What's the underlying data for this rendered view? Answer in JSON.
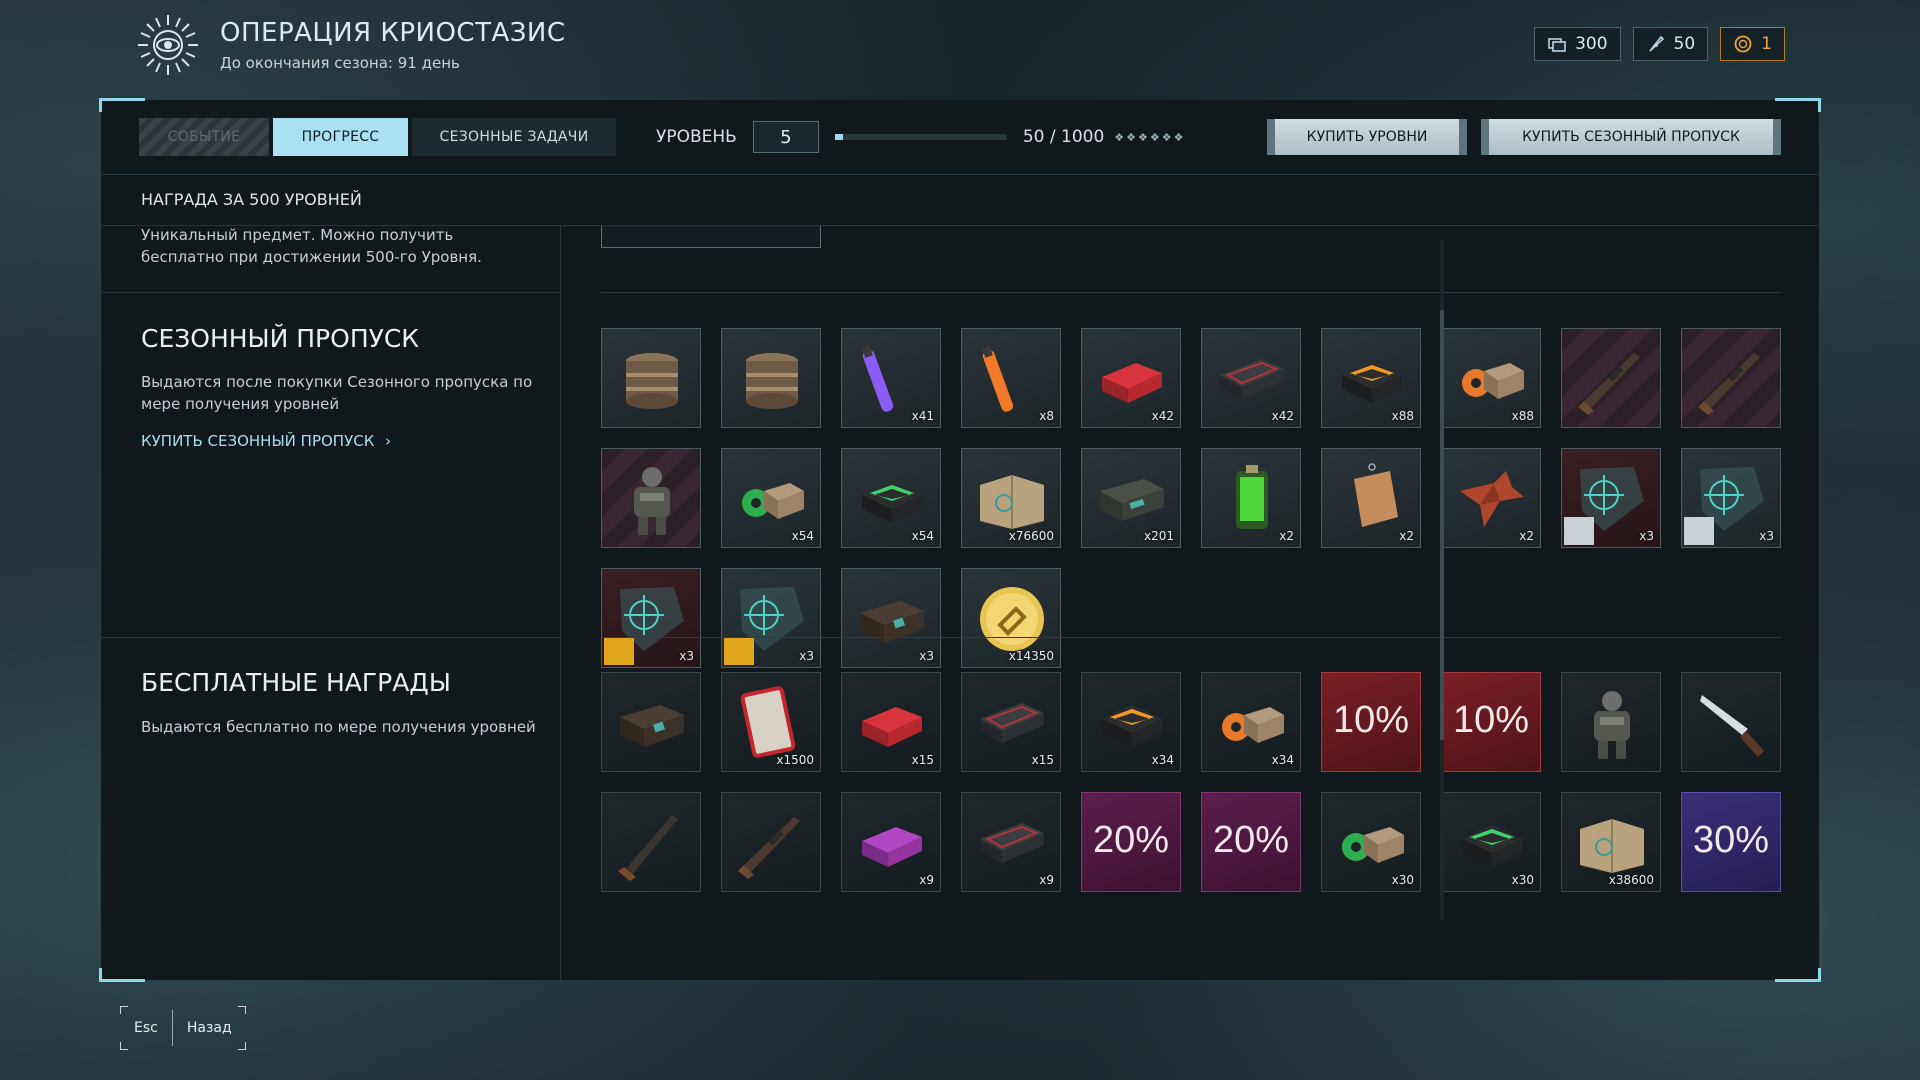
{
  "header": {
    "title": "ОПЕРАЦИЯ КРИОСТАЗИС",
    "subtitle": "До окончания сезона: 91 день"
  },
  "currencies": [
    {
      "icon": "tickets-icon",
      "value": "300"
    },
    {
      "icon": "feather-token-icon",
      "value": "50"
    },
    {
      "icon": "gold-coin-icon",
      "value": "1"
    }
  ],
  "tabs": {
    "event": "СОБЫТИЕ",
    "progress": "ПРОГРЕСС",
    "tasks": "СЕЗОННЫЕ ЗАДАЧИ"
  },
  "level": {
    "label": "УРОВЕНЬ",
    "value": "5",
    "xp_text": "50 / 1000",
    "progress_fraction": 0.05,
    "stars_text": "❖❖❖❖❖❖"
  },
  "buttons": {
    "buy_levels": "КУПИТЬ УРОВНИ",
    "buy_pass": "КУПИТЬ СЕЗОННЫЙ ПРОПУСК"
  },
  "reward500": {
    "title": "НАГРАДА ЗА 500 УРОВНЕЙ",
    "description": "Уникальный предмет. Можно получить бесплатно при достижении 500-го Уровня."
  },
  "season_pass": {
    "title": "СЕЗОННЫЙ ПРОПУСК",
    "description": "Выдаются после покупки Сезонного пропуска по мере получения уровней",
    "link": "КУПИТЬ СЕЗОННЫЙ ПРОПУСК"
  },
  "free_rewards": {
    "title": "БЕСПЛАТНЫЕ НАГРАДЫ",
    "description": "Выдаются бесплатно по мере получения уровней"
  },
  "pass_items": [
    {
      "icon": "drum-container-icon",
      "qty": "",
      "bg": ""
    },
    {
      "icon": "drum-container-icon",
      "qty": "",
      "bg": ""
    },
    {
      "icon": "purple-glowstick-icon",
      "qty": "x41",
      "bg": ""
    },
    {
      "icon": "orange-glowstick-icon",
      "qty": "x8",
      "bg": ""
    },
    {
      "icon": "red-case-icon",
      "qty": "x42",
      "bg": ""
    },
    {
      "icon": "weapon-case-icon",
      "qty": "x42",
      "bg": ""
    },
    {
      "icon": "orange-x-box-icon",
      "qty": "x88",
      "bg": ""
    },
    {
      "icon": "orange-box-icon",
      "qty": "x88",
      "bg": ""
    },
    {
      "icon": "rifle-icon",
      "qty": "",
      "bg": "stripe"
    },
    {
      "icon": "rifle-icon",
      "qty": "",
      "bg": "stripe"
    },
    {
      "icon": "armored-soldier-icon",
      "qty": "",
      "bg": "stripe"
    },
    {
      "icon": "green-box-icon",
      "qty": "x54",
      "bg": ""
    },
    {
      "icon": "green-x-box-icon",
      "qty": "x54",
      "bg": ""
    },
    {
      "icon": "map-icon",
      "qty": "x76600",
      "bg": ""
    },
    {
      "icon": "ammo-crate-icon",
      "qty": "x201",
      "bg": ""
    },
    {
      "icon": "green-canister-icon",
      "qty": "x2",
      "bg": ""
    },
    {
      "icon": "dog-tag-icon",
      "qty": "x2",
      "bg": ""
    },
    {
      "icon": "origami-bird-icon",
      "qty": "x2",
      "bg": ""
    },
    {
      "icon": "camo-pattern-icon",
      "qty": "x3",
      "bg": "darkred"
    },
    {
      "icon": "camo-pattern-icon",
      "qty": "x3",
      "bg": ""
    },
    {
      "icon": "camo-pattern-icon",
      "qty": "x3",
      "bg": "darkred"
    },
    {
      "icon": "camo-pattern-icon",
      "qty": "x3",
      "bg": ""
    },
    {
      "icon": "chest-icon",
      "qty": "x3",
      "bg": ""
    },
    {
      "icon": "gold-chain-coin-icon",
      "qty": "x14350",
      "bg": ""
    }
  ],
  "free_items": [
    {
      "icon": "chest-icon",
      "qty": "",
      "bg": "dark",
      "pct": ""
    },
    {
      "icon": "red-card-icon",
      "qty": "x1500",
      "bg": "dark",
      "pct": ""
    },
    {
      "icon": "red-case-icon",
      "qty": "x15",
      "bg": "dark",
      "pct": ""
    },
    {
      "icon": "weapon-case-icon",
      "qty": "x15",
      "bg": "dark",
      "pct": ""
    },
    {
      "icon": "orange-x-box-icon",
      "qty": "x34",
      "bg": "dark",
      "pct": ""
    },
    {
      "icon": "orange-box-icon",
      "qty": "x34",
      "bg": "dark",
      "pct": ""
    },
    {
      "icon": "discount-icon",
      "qty": "",
      "bg": "redbg",
      "pct": "10%"
    },
    {
      "icon": "discount-icon",
      "qty": "",
      "bg": "redbg",
      "pct": "10%"
    },
    {
      "icon": "armored-soldier-icon",
      "qty": "",
      "bg": "dark",
      "pct": ""
    },
    {
      "icon": "knife-icon",
      "qty": "",
      "bg": "dark",
      "pct": ""
    },
    {
      "icon": "shotgun-icon",
      "qty": "",
      "bg": "dark",
      "pct": ""
    },
    {
      "icon": "rifle-icon",
      "qty": "",
      "bg": "dark",
      "pct": ""
    },
    {
      "icon": "purple-case-icon",
      "qty": "x9",
      "bg": "dark",
      "pct": ""
    },
    {
      "icon": "weapon-case-icon",
      "qty": "x9",
      "bg": "dark",
      "pct": ""
    },
    {
      "icon": "discount-icon",
      "qty": "",
      "bg": "purplebg",
      "pct": "20%"
    },
    {
      "icon": "discount-icon",
      "qty": "",
      "bg": "purplebg",
      "pct": "20%"
    },
    {
      "icon": "green-box-icon",
      "qty": "x30",
      "bg": "dark",
      "pct": ""
    },
    {
      "icon": "green-x-box-icon",
      "qty": "x30",
      "bg": "dark",
      "pct": ""
    },
    {
      "icon": "map-icon",
      "qty": "x38600",
      "bg": "dark",
      "pct": ""
    },
    {
      "icon": "discount-icon",
      "qty": "",
      "bg": "bluebg",
      "pct": "30%"
    }
  ],
  "footer": {
    "esc": "Esc",
    "back": "Назад"
  }
}
